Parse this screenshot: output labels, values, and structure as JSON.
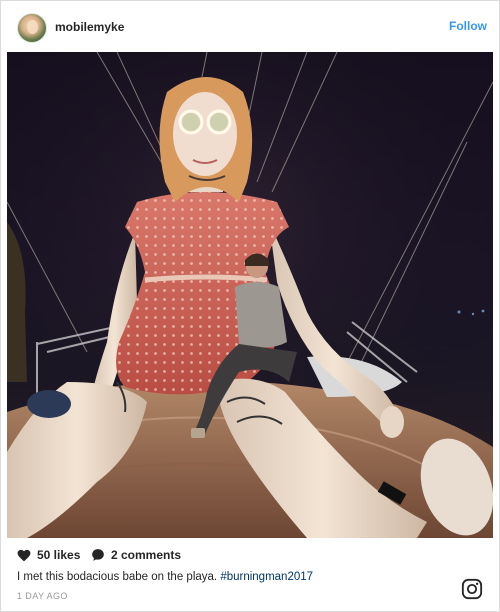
{
  "header": {
    "username": "mobilemyke",
    "follow_label": "Follow"
  },
  "photo": {
    "description_icon": "photo"
  },
  "footer": {
    "likes": "50 likes",
    "comments": "2 comments",
    "caption_text": "I met this bodacious babe on the playa. ",
    "hashtag": "#burningman2017",
    "timestamp": "1 DAY AGO",
    "brand_icon": "instagram-logo-icon"
  },
  "colors": {
    "accent": "#3897f0",
    "hashtag": "#003569",
    "text": "#262626",
    "muted": "#999999"
  }
}
